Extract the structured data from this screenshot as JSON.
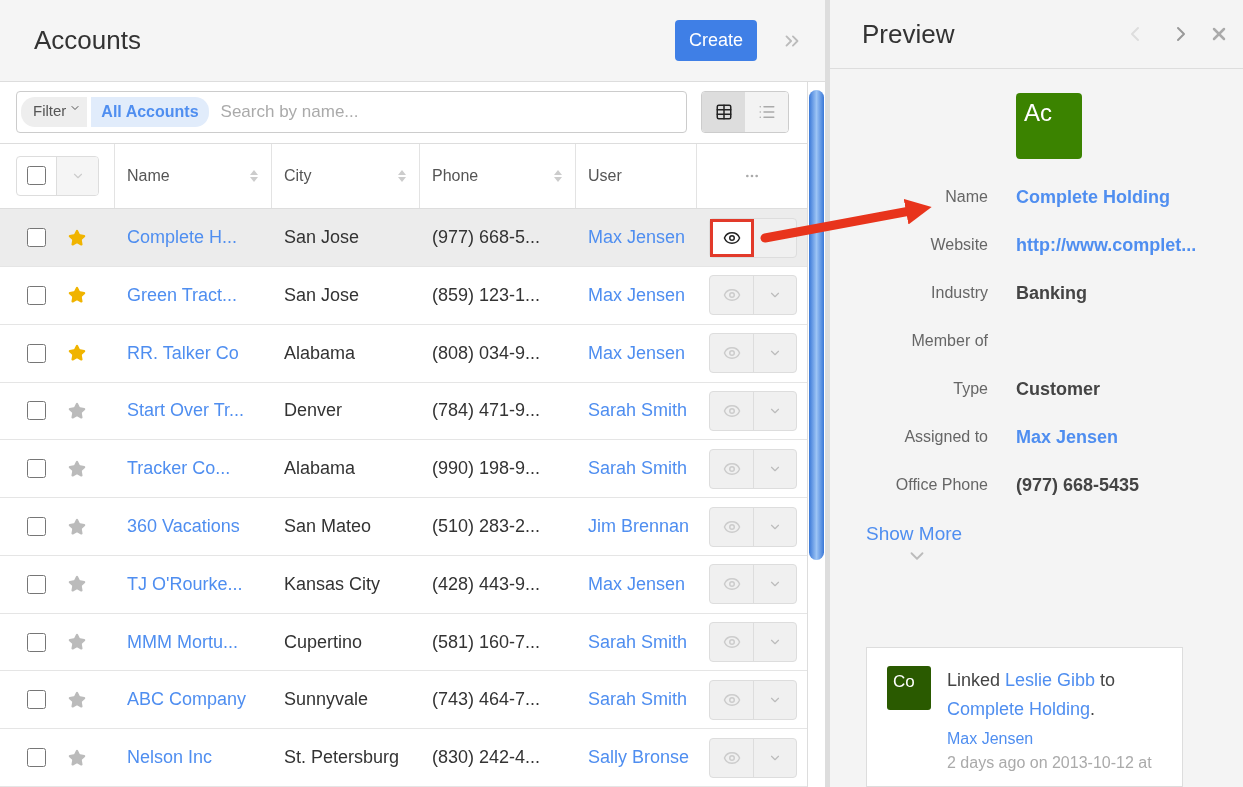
{
  "list": {
    "title": "Accounts",
    "create_label": "Create",
    "filter": {
      "label": "Filter",
      "chip": "All Accounts",
      "placeholder": "Search by name..."
    },
    "select_all_checked": false,
    "view_modes": [
      {
        "kind": "table",
        "selected": true
      },
      {
        "kind": "list",
        "selected": false
      }
    ],
    "columns": [
      {
        "label": "Name",
        "sortable": true
      },
      {
        "label": "City",
        "sortable": true
      },
      {
        "label": "Phone",
        "sortable": true
      },
      {
        "label": "User",
        "sortable": false
      }
    ],
    "rows": [
      {
        "name": "Complete H...",
        "city": "San Jose",
        "phone": "(977) 668-5...",
        "user": "Max Jensen",
        "favorite": true,
        "checked": false,
        "highlighted": true
      },
      {
        "name": "Green Tract...",
        "city": "San Jose",
        "phone": "(859) 123-1...",
        "user": "Max Jensen",
        "favorite": true,
        "checked": false,
        "highlighted": false
      },
      {
        "name": "RR. Talker Co",
        "city": "Alabama",
        "phone": "(808) 034-9...",
        "user": "Max Jensen",
        "favorite": true,
        "checked": false,
        "highlighted": false
      },
      {
        "name": "Start Over Tr...",
        "city": "Denver",
        "phone": "(784) 471-9...",
        "user": "Sarah Smith",
        "favorite": false,
        "checked": false,
        "highlighted": false
      },
      {
        "name": "Tracker Co...",
        "city": "Alabama",
        "phone": "(990) 198-9...",
        "user": "Sarah Smith",
        "favorite": false,
        "checked": false,
        "highlighted": false
      },
      {
        "name": "360 Vacations",
        "city": "San Mateo",
        "phone": "(510) 283-2...",
        "user": "Jim Brennan",
        "favorite": false,
        "checked": false,
        "highlighted": false
      },
      {
        "name": "TJ O'Rourke...",
        "city": "Kansas City",
        "phone": "(428) 443-9...",
        "user": "Max Jensen",
        "favorite": false,
        "checked": false,
        "highlighted": false
      },
      {
        "name": "MMM Mortu...",
        "city": "Cupertino",
        "phone": "(581) 160-7...",
        "user": "Sarah Smith",
        "favorite": false,
        "checked": false,
        "highlighted": false
      },
      {
        "name": "ABC Company",
        "city": "Sunnyvale",
        "phone": "(743) 464-7...",
        "user": "Sarah Smith",
        "favorite": false,
        "checked": false,
        "highlighted": false
      },
      {
        "name": "Nelson Inc",
        "city": "St. Petersburg",
        "phone": "(830) 242-4...",
        "user": "Sally Bronse",
        "favorite": false,
        "checked": false,
        "highlighted": false
      }
    ]
  },
  "preview": {
    "title": "Preview",
    "prev_disabled": true,
    "next_disabled": false,
    "avatar": "Ac",
    "fields": [
      {
        "label": "Name",
        "value": "Complete Holding",
        "kind": "link"
      },
      {
        "label": "Website",
        "value": "http://www.complet...",
        "kind": "link"
      },
      {
        "label": "Industry",
        "value": "Banking",
        "kind": "text"
      },
      {
        "label": "Member of",
        "kind": "empty"
      },
      {
        "label": "Type",
        "value": "Customer",
        "kind": "text"
      },
      {
        "label": "Assigned to",
        "value": "Max Jensen",
        "kind": "link"
      },
      {
        "label": "Office Phone",
        "value": "(977) 668-5435",
        "kind": "text"
      }
    ],
    "show_more": "Show More",
    "activity": {
      "avatar": "Co",
      "parts": [
        {
          "text": "Linked ",
          "kind": "text"
        },
        {
          "text": "Leslie Gibb",
          "kind": "link"
        },
        {
          "text": " to ",
          "kind": "text"
        },
        {
          "text": "Complete Holding",
          "kind": "link"
        },
        {
          "text": ".",
          "kind": "text"
        }
      ],
      "author": "Max Jensen",
      "time": "2 days ago on 2013-10-12 at"
    }
  }
}
